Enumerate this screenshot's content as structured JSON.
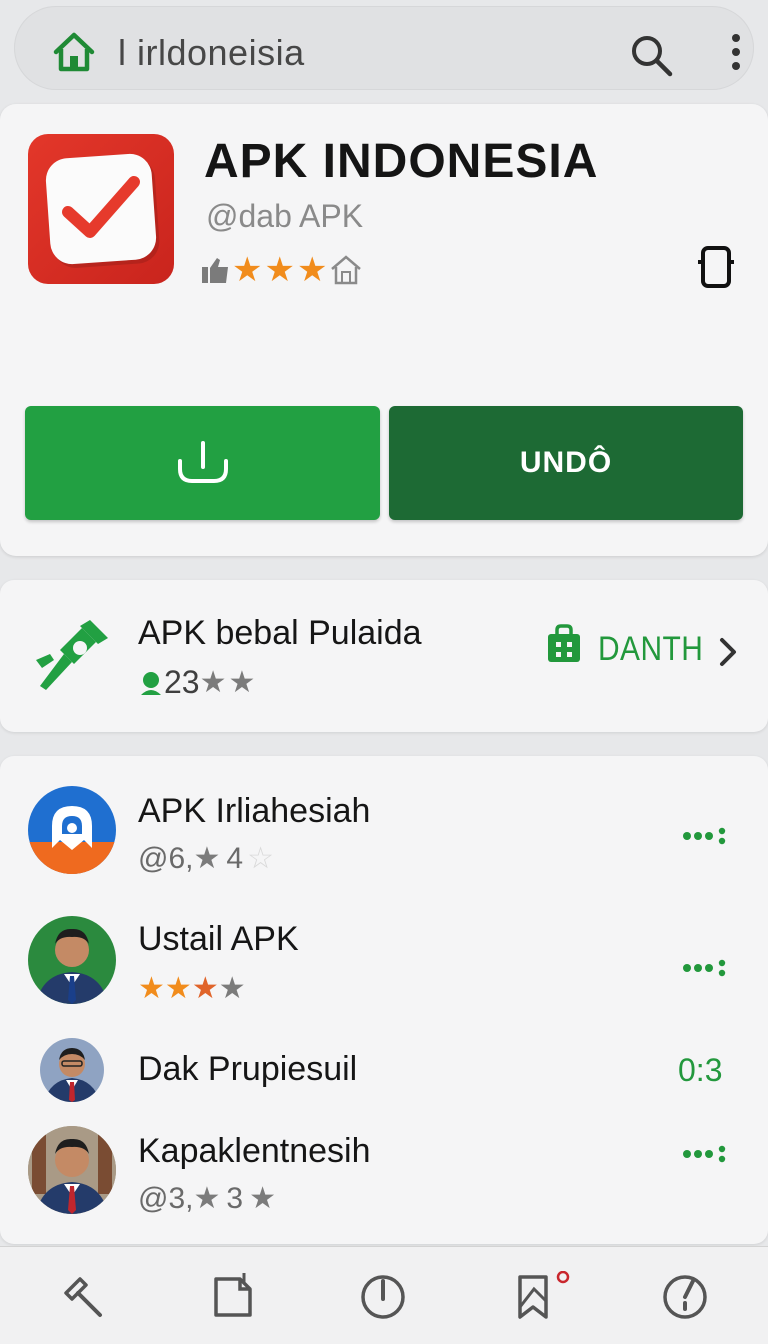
{
  "search_bar": {
    "url": "l irldoneisia",
    "home_icon": "home-icon",
    "search_icon": "search-icon",
    "menu_icon": "more-vertical-icon"
  },
  "app": {
    "title": "APK INDONESIA",
    "developer": "@dab APK",
    "rating_stars": 3,
    "install_icon": "download-icon",
    "undo_label": "UNDÔ",
    "device_icon": "device-icon",
    "colors": {
      "install": "#22a042",
      "undo": "#1d6a34",
      "icon_bg": "#e3372a"
    }
  },
  "promo": {
    "title": "APK bebal Pulaida",
    "count": "23",
    "stars": 2,
    "action_label": "DANTH",
    "icon": "pin-icon",
    "action_icon": "bag-icon"
  },
  "list": [
    {
      "title": "APK Irliahesiah",
      "sub_prefix": "@6,",
      "sub_value": "4",
      "action": "more-dots"
    },
    {
      "title": "Ustail APK",
      "stars": 4,
      "action": "more-dots"
    },
    {
      "title": "Dak Prupiesuil",
      "count": "0:3",
      "action": "count"
    },
    {
      "title": "Kapaklentnesih",
      "sub_prefix": "@3,",
      "sub_value": "3",
      "action": "more-dots"
    }
  ],
  "bottom_nav": [
    "back-hammer-icon",
    "document-icon",
    "power-icon",
    "bookmark-icon",
    "timer-icon"
  ]
}
